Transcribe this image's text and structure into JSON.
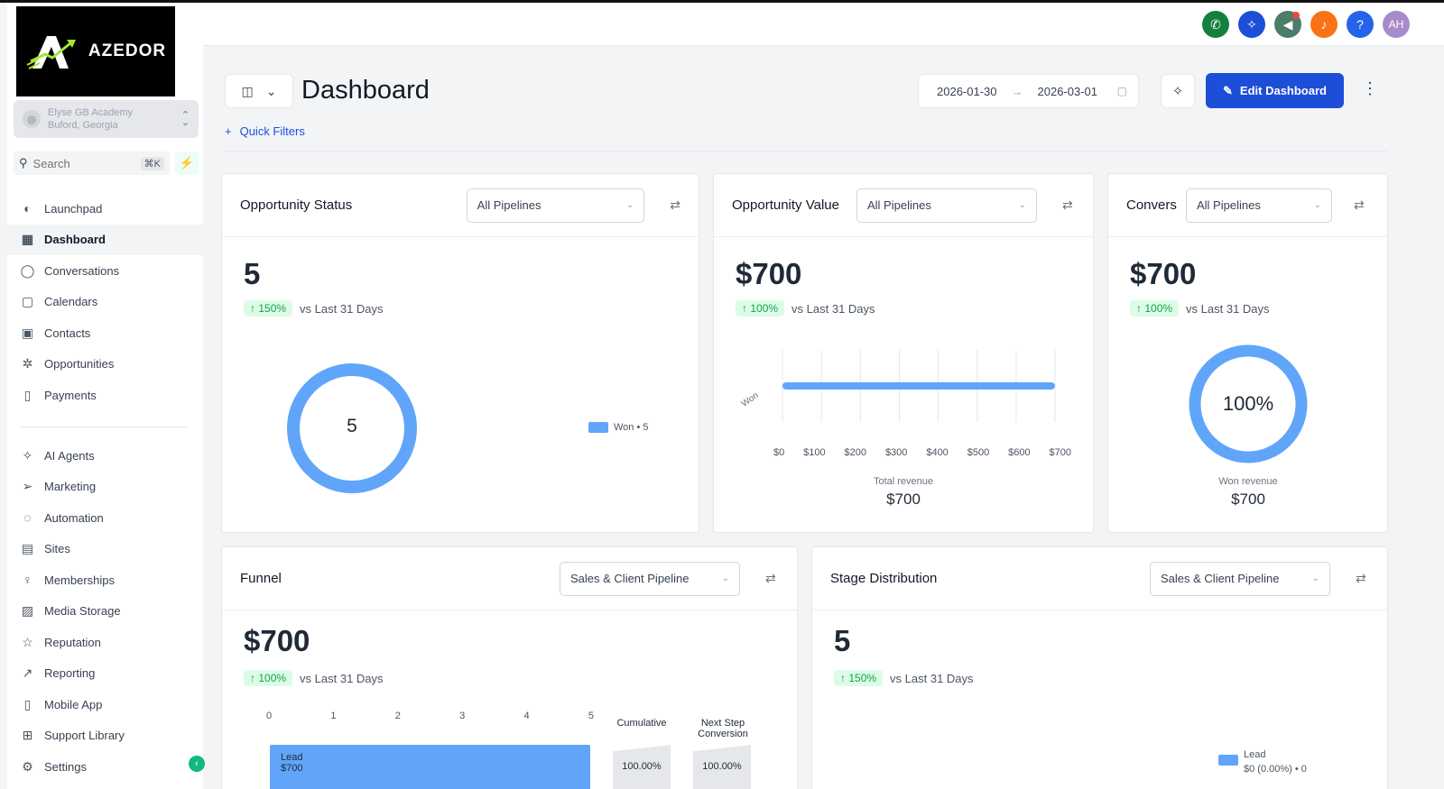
{
  "brand": {
    "name": "AZEDOR"
  },
  "location": {
    "name": "Elyse GB Academy",
    "city": "Buford, Georgia"
  },
  "search": {
    "placeholder": "Search",
    "shortcut": "⌘K"
  },
  "sidebar": {
    "items": [
      {
        "label": "Launchpad",
        "icon": "launchpad-icon"
      },
      {
        "label": "Dashboard",
        "icon": "dashboard-icon"
      },
      {
        "label": "Conversations",
        "icon": "chat-icon"
      },
      {
        "label": "Calendars",
        "icon": "calendar-icon"
      },
      {
        "label": "Contacts",
        "icon": "contacts-icon"
      },
      {
        "label": "Opportunities",
        "icon": "opportunities-icon"
      },
      {
        "label": "Payments",
        "icon": "payments-icon"
      }
    ],
    "items2": [
      {
        "label": "AI Agents",
        "icon": "sparkle-icon"
      },
      {
        "label": "Marketing",
        "icon": "send-icon"
      },
      {
        "label": "Automation",
        "icon": "automation-icon"
      },
      {
        "label": "Sites",
        "icon": "sites-icon"
      },
      {
        "label": "Memberships",
        "icon": "memberships-icon"
      },
      {
        "label": "Media Storage",
        "icon": "image-icon"
      },
      {
        "label": "Reputation",
        "icon": "star-icon"
      },
      {
        "label": "Reporting",
        "icon": "trend-icon"
      },
      {
        "label": "Mobile App",
        "icon": "phone-icon"
      },
      {
        "label": "Support Library",
        "icon": "library-icon"
      },
      {
        "label": "Settings",
        "icon": "gear-icon"
      }
    ]
  },
  "header": {
    "icons": [
      {
        "name": "phone-icon",
        "color": "#15803d"
      },
      {
        "name": "tools-icon",
        "color": "#1d4ed8"
      },
      {
        "name": "megaphone-icon",
        "color": "#4b7d6a"
      },
      {
        "name": "bell-icon",
        "color": "#f97316"
      },
      {
        "name": "help-icon",
        "color": "#2563eb"
      },
      {
        "name": "avatar",
        "color": "#a78bca",
        "label": "AH"
      }
    ]
  },
  "page": {
    "title": "Dashboard",
    "quick_filters": "Quick Filters",
    "date_from": "2026-01-30",
    "date_to": "2026-03-01",
    "edit_label": "Edit Dashboard"
  },
  "cards": {
    "opp_status": {
      "title": "Opportunity Status",
      "select": "All Pipelines",
      "value": "5",
      "change": "150%",
      "vs": "vs Last 31 Days",
      "donut_center": "5",
      "legend": "Won • 5"
    },
    "opp_value": {
      "title": "Opportunity Value",
      "select": "All Pipelines",
      "value": "$700",
      "change": "100%",
      "vs": "vs Last 31 Days",
      "y_label": "Won",
      "x_ticks": [
        "$0",
        "$100",
        "$200",
        "$300",
        "$400",
        "$500",
        "$600",
        "$700"
      ],
      "total_label": "Total revenue",
      "total_value": "$700"
    },
    "conversion": {
      "title": "Conversion",
      "select": "All Pipelines",
      "value": "$700",
      "change": "100%",
      "vs": "vs Last 31 Days",
      "donut_center": "100%",
      "won_label": "Won revenue",
      "won_value": "$700"
    },
    "funnel": {
      "title": "Funnel",
      "select": "Sales & Client Pipeline",
      "value": "$700",
      "change": "100%",
      "vs": "vs Last 31 Days",
      "x_ticks": [
        "0",
        "1",
        "2",
        "3",
        "4",
        "5"
      ],
      "bar_label": "Lead",
      "bar_sub": "$700",
      "col1": "Cumulative",
      "col2a": "Next Step",
      "col2b": "Conversion",
      "col1_value": "100.00%",
      "col2_value": "100.00%"
    },
    "stage": {
      "title": "Stage Distribution",
      "select": "Sales & Client Pipeline",
      "value": "5",
      "change": "150%",
      "vs": "vs Last 31 Days",
      "legend_label": "Lead",
      "legend_value": "$0 (0.00%) • 0"
    }
  },
  "chart_data": [
    {
      "type": "pie",
      "categories": [
        "Won"
      ],
      "values": [
        5
      ]
    },
    {
      "type": "bar",
      "categories": [
        "Won"
      ],
      "values": [
        700
      ],
      "xlim": [
        0,
        700
      ]
    },
    {
      "type": "pie",
      "categories": [
        "Won"
      ],
      "values": [
        100
      ]
    },
    {
      "type": "bar",
      "categories": [
        "Lead"
      ],
      "values": [
        5
      ],
      "xlim": [
        0,
        5
      ]
    }
  ]
}
